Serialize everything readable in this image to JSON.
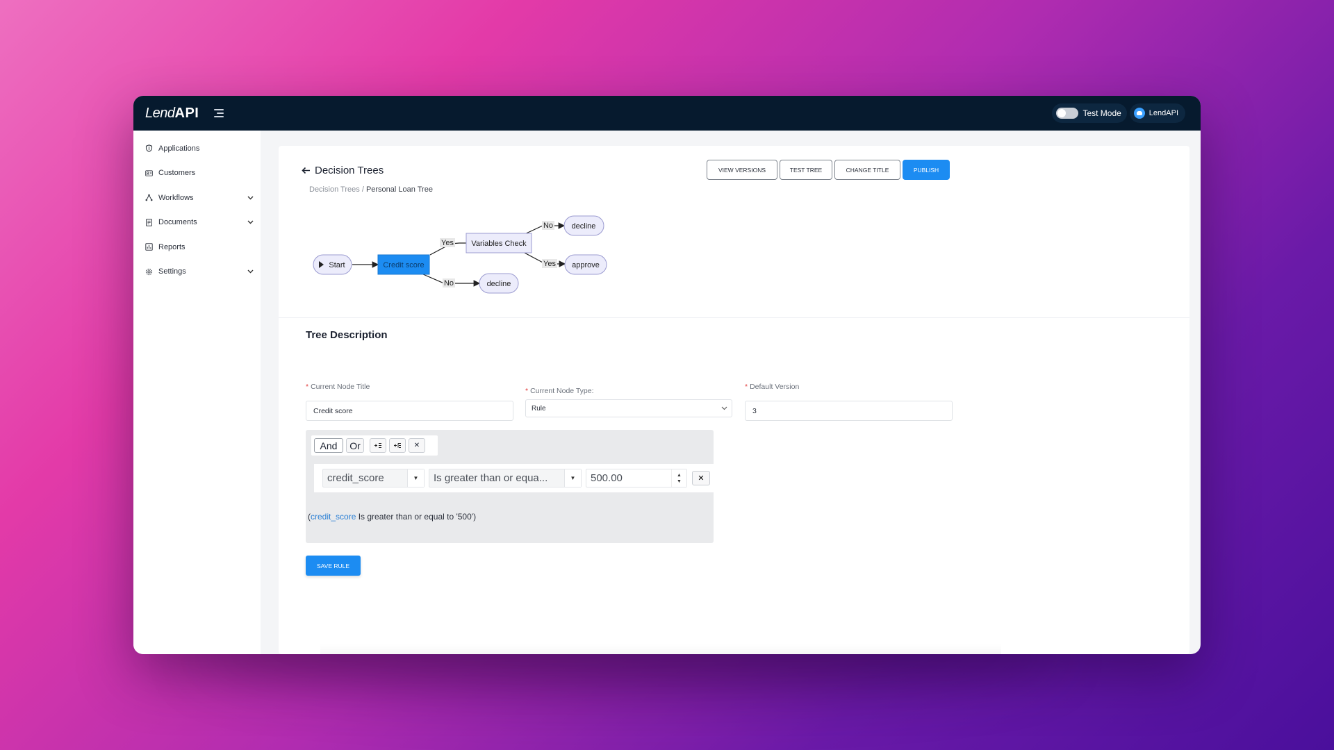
{
  "header": {
    "logo_lend": "Lend",
    "logo_api": "API",
    "test_mode_label": "Test Mode",
    "user_label": "LendAPI"
  },
  "sidebar": {
    "items": [
      {
        "label": "Applications",
        "icon": "shield-icon",
        "chevron": false
      },
      {
        "label": "Customers",
        "icon": "users-icon",
        "chevron": false
      },
      {
        "label": "Workflows",
        "icon": "workflow-icon",
        "chevron": true
      },
      {
        "label": "Documents",
        "icon": "document-icon",
        "chevron": true
      },
      {
        "label": "Reports",
        "icon": "chart-icon",
        "chevron": false
      },
      {
        "label": "Settings",
        "icon": "gear-icon",
        "chevron": true
      }
    ]
  },
  "page": {
    "title": "Decision Trees",
    "breadcrumb_root": "Decision Trees",
    "breadcrumb_sep": " / ",
    "breadcrumb_current": "Personal Loan Tree"
  },
  "actions": {
    "view_versions": "VIEW VERSIONS",
    "test_tree": "TEST TREE",
    "change_title": "CHANGE TITLE",
    "publish": "PUBLISH"
  },
  "flow": {
    "nodes": {
      "start": "Start",
      "credit_score": "Credit score",
      "variables_check": "Variables Check",
      "decline_top": "decline",
      "approve": "approve",
      "decline_bottom": "decline"
    },
    "edges": {
      "yes_1": "Yes",
      "no_1": "No",
      "no_2": "No",
      "yes_2": "Yes"
    },
    "colors": {
      "selected_node": "#1c8cf2",
      "node_fill": "#ececfb",
      "node_stroke": "#9b9bd0"
    }
  },
  "form": {
    "section_title": "Tree Description",
    "node_title_label": "Current Node Title",
    "node_title_value": "Credit score",
    "node_type_label": "Current Node Type:",
    "node_type_value": "Rule",
    "default_version_label": "Default Version",
    "default_version_value": "3"
  },
  "rule_builder": {
    "and_label": "And",
    "or_label": "Or",
    "add_rule_icon": "add-rule-icon",
    "add_group_icon": "add-group-icon",
    "remove_label": "✕",
    "field_value": "credit_score",
    "operator_value": "Is greater than or equa...",
    "number_value": "500.00",
    "summary_open": "(",
    "summary_field": "credit_score",
    "summary_rest": " Is greater than or equal to '500')",
    "save_label": "SAVE RULE"
  }
}
